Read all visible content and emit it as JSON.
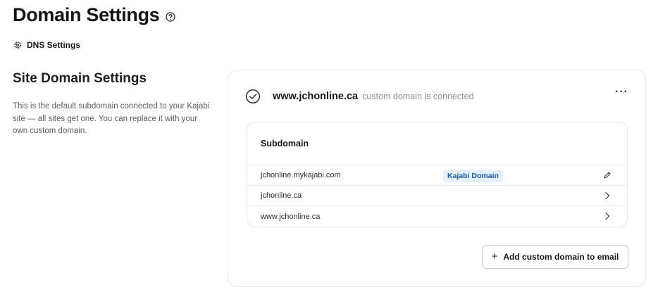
{
  "header": {
    "title": "Domain Settings",
    "help_icon": "question-circle-icon"
  },
  "dns_link": {
    "icon": "gear-icon",
    "label": "DNS Settings"
  },
  "section": {
    "title": "Site Domain Settings",
    "description": "This is the default subdomain connected to your Kajabi site — all sites get one. You can replace it with your own custom domain."
  },
  "domain_card": {
    "status_icon": "check-circle-icon",
    "domain": "www.jchonline.ca",
    "status_text": "custom domain is connected",
    "more_label": "···",
    "table": {
      "header": "Subdomain",
      "rows": [
        {
          "domain": "jchonline.mykajabi.com",
          "badge": "Kajabi Domain",
          "action_icon": "pencil-icon"
        },
        {
          "domain": "jchonline.ca",
          "badge": "",
          "action_icon": "chevron-right-icon"
        },
        {
          "domain": "www.jchonline.ca",
          "badge": "",
          "action_icon": "chevron-right-icon"
        }
      ]
    },
    "add_button": {
      "icon": "+",
      "label": "Add custom domain to email"
    }
  },
  "colors": {
    "badge_bg": "#e5f0fb",
    "badge_text": "#1c5aa6",
    "border": "#e7e7ea",
    "muted_text": "#8f8f95"
  }
}
